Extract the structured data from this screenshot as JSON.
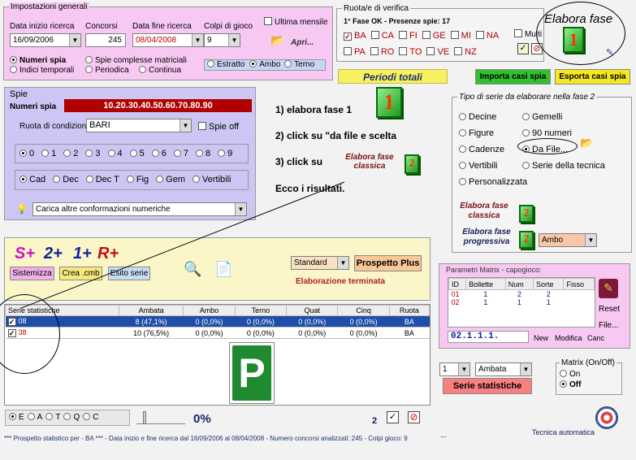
{
  "general": {
    "title": "Impostazioni generali",
    "start_label": "Data inizio ricerca",
    "start_value": "16/09/2006",
    "contests_label": "Concorsi",
    "contests_value": "245",
    "end_label": "Data fine ricerca",
    "end_value": "08/04/2008",
    "hits_label": "Colpi di gioco",
    "hits_value": "9",
    "last_month_label": "Ultima mensile",
    "open_label": "Apri...",
    "opt1": "Numeri spia",
    "opt2": "Indici temporali",
    "opt3": "Spie complesse matriciali",
    "opt4": "Periodica",
    "opt5": "Continua",
    "play1": "Estratto",
    "play2": "Ambo",
    "play3": "Terno"
  },
  "verify": {
    "title": "Ruota/e di verifica",
    "status": "1° Fase OK - Presenze spie: 17",
    "wheels_row1": [
      "BA",
      "CA",
      "FI",
      "GE",
      "MI",
      "NA"
    ],
    "wheels_row2": [
      "PA",
      "RO",
      "TO",
      "VE",
      "NZ"
    ],
    "multi_label": "Multi"
  },
  "elabora_fase": "Elabora fase",
  "periodi_totali": "Periodi totali",
  "import_btn": "Importa casi spia",
  "export_btn": "Esporta casi spia",
  "spie": {
    "title": "Spie",
    "numbers_label": "Numeri spia",
    "numbers_value": "10.20.30.40.50.60.70.80.90",
    "ruota_label": "Ruota di condizione",
    "ruota_value": "BARI",
    "spie_off": "Spie off",
    "digits": [
      "0",
      "1",
      "2",
      "3",
      "4",
      "5",
      "6",
      "7",
      "8",
      "9"
    ],
    "types": [
      "Cad",
      "Dec",
      "Dec T",
      "Fig",
      "Gem",
      "Vertibili"
    ],
    "load_more": "Carica altre conformazioni numeriche"
  },
  "instructions": {
    "step1": "1) elabora fase 1",
    "step2": "2) click su \"da file e scelta",
    "step3": "3) click su",
    "classica": "Elabora fase classica",
    "result": "Ecco i risultati."
  },
  "series_type": {
    "title": "Tipo di serie da elaborare nella fase 2",
    "col1": [
      "Decine",
      "Figure",
      "Cadenze",
      "Vertibili",
      "Personalizzata"
    ],
    "col2": [
      "Gemelli",
      "90 numeri",
      "Da File...",
      "Serie della tecnica"
    ],
    "classica": "Elabora fase classica",
    "progressiva": "Elabora fase progressiva",
    "ambo": "Ambo"
  },
  "formula": {
    "s": "S+",
    "two": "2+",
    "one": "1+",
    "r": "R+",
    "btn_sistemizza": "Sistemizza",
    "btn_crea": "Crea .cmb",
    "btn_esito": "Esito serie",
    "standard": "Standard",
    "prospetto": "Prospetto Plus",
    "done": "Elaborazione terminata"
  },
  "matrix": {
    "title": "Parametri Matrix - capogioco:",
    "headers": [
      "ID",
      "Bollette",
      "Num",
      "Sorte",
      "Fisso"
    ],
    "rows": [
      [
        "01",
        "1",
        "2",
        "2",
        ""
      ],
      [
        "02",
        "1",
        "1",
        "1",
        ""
      ]
    ],
    "code": "02.1.1.1.",
    "new": "New",
    "modify": "Modifica",
    "cancel": "Canc",
    "reset": "Reset",
    "file": "File..."
  },
  "stats": {
    "headers": [
      "Serie statistiche",
      "Ambata",
      "Ambo",
      "Terno",
      "Quat",
      "Cinq",
      "Ruota"
    ],
    "rows": [
      [
        "08",
        "8 (47,1%)",
        "0 (0,0%)",
        "0 (0,0%)",
        "0 (0,0%)",
        "0 (0,0%)",
        "BA"
      ],
      [
        "38",
        "10 (76,5%)",
        "0 (0,0%)",
        "0 (0,0%)",
        "0 (0,0%)",
        "0 (0,0%)",
        "BA"
      ]
    ]
  },
  "parking": "P",
  "stat_ctrl": {
    "num": "1",
    "ambata": "Ambata",
    "btn": "Serie statistiche",
    "matrix_title": "Matrix (On/Off)",
    "on": "On",
    "off": "Off"
  },
  "bottom": {
    "radios": [
      "E",
      "A",
      "T",
      "Q",
      "C"
    ],
    "percent": "0%",
    "count": "2",
    "dots": "...",
    "tecnica": "Tecnica automatica"
  },
  "status_line": "*** Prospetto statistico per - BA *** - Data inizio e fine ricerca dal 16/09/2006 al 08/04/2008 - Numero concorsi analizzati: 245 - Colpi gioco: 9"
}
